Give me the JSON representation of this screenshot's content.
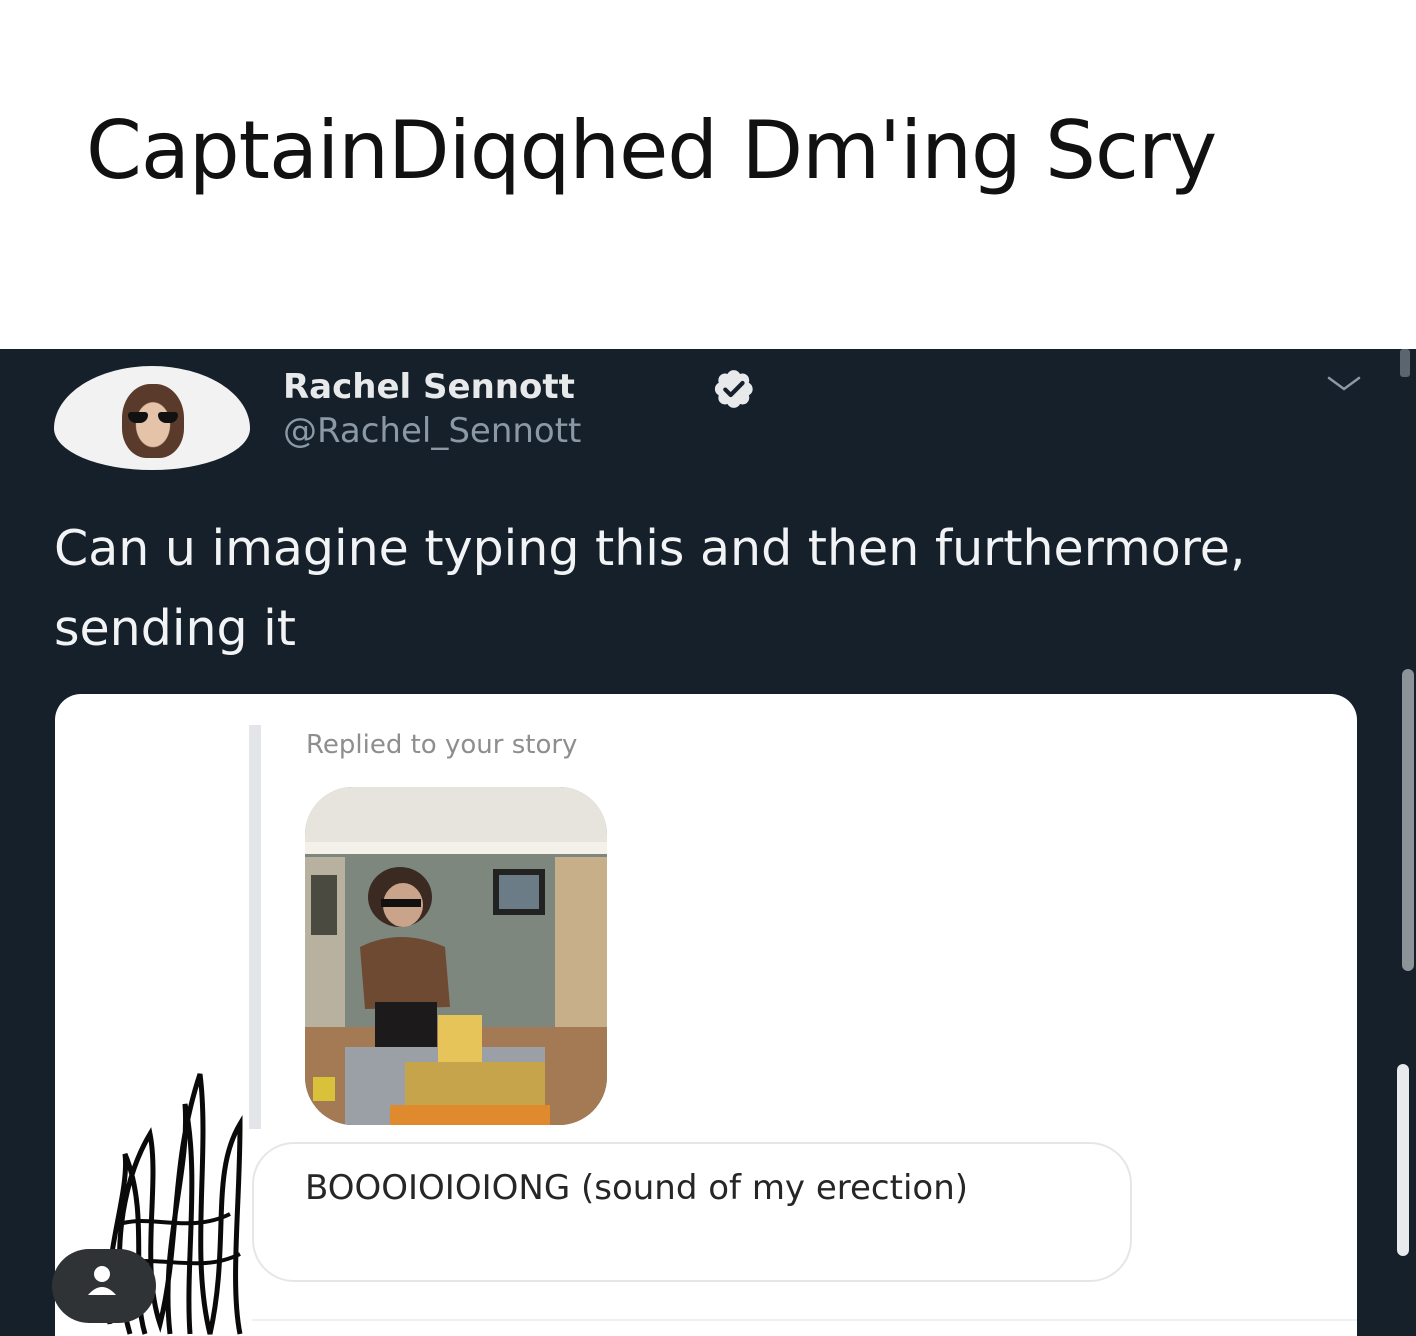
{
  "meme": {
    "caption": "CaptainDiqqhed Dm'ing Scry"
  },
  "tweet": {
    "author": {
      "display_name": "Rachel Sennott",
      "handle": "@Rachel_Sennott",
      "verified": true
    },
    "text": "Can u imagine typing this and then furthermore, sending it",
    "embedded_dm": {
      "reply_context": "Replied to your story",
      "message": "BOOOIOIOIONG (sound of my erection)"
    }
  },
  "colors": {
    "background": "#15202b",
    "text_primary": "#e7e9ea",
    "text_secondary": "#8b98a5",
    "verified_badge": "#e7e9ea"
  },
  "icons": {
    "verified": "verified-badge-icon",
    "more": "chevron-down-icon",
    "profile": "person-icon"
  }
}
